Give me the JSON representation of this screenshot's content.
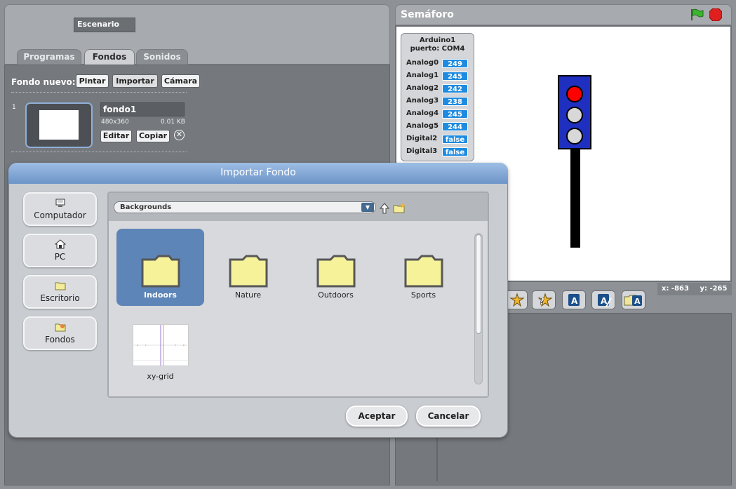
{
  "sprite": {
    "name": "Escenario"
  },
  "tabs": [
    {
      "label": "Programas"
    },
    {
      "label": "Fondos"
    },
    {
      "label": "Sonidos"
    }
  ],
  "backgrounds": {
    "new_label": "Fondo nuevo:",
    "paint_label": "Pintar",
    "import_label": "Importar",
    "camera_label": "Cámara",
    "item": {
      "index": "1",
      "name": "fondo1",
      "size": "480x360",
      "kb": "0.01 KB",
      "edit_label": "Editar",
      "copy_label": "Copiar",
      "delete_glyph": "✕"
    }
  },
  "stage": {
    "title": "Semáforo",
    "monitor": {
      "title": "Arduino1\npuerto: COM4",
      "rows": [
        {
          "label": "Analog0",
          "value": "249"
        },
        {
          "label": "Analog1",
          "value": "245"
        },
        {
          "label": "Analog2",
          "value": "242"
        },
        {
          "label": "Analog3",
          "value": "238"
        },
        {
          "label": "Analog4",
          "value": "245"
        },
        {
          "label": "Analog5",
          "value": "244"
        },
        {
          "label": "Digital2",
          "value": "false"
        },
        {
          "label": "Digital3",
          "value": "false"
        }
      ]
    },
    "mouse_x": "x: -863",
    "mouse_y": "y: -265",
    "colors": {
      "light_red": "#ff0000",
      "light_off": "#d8d8d8",
      "housing": "#1f2fbf"
    }
  },
  "dialog": {
    "title": "Importar Fondo",
    "places": [
      {
        "label": "Computador",
        "icon": "computer-icon"
      },
      {
        "label": "PC",
        "icon": "home-icon"
      },
      {
        "label": "Escritorio",
        "icon": "folder-icon"
      },
      {
        "label": "Fondos",
        "icon": "backgrounds-icon"
      }
    ],
    "path": "Backgrounds",
    "files": [
      {
        "label": "Indoors",
        "selected": true
      },
      {
        "label": "Nature"
      },
      {
        "label": "Outdoors"
      },
      {
        "label": "Sports"
      },
      {
        "label": "xy-grid"
      }
    ],
    "ok_label": "Aceptar",
    "cancel_label": "Cancelar"
  }
}
